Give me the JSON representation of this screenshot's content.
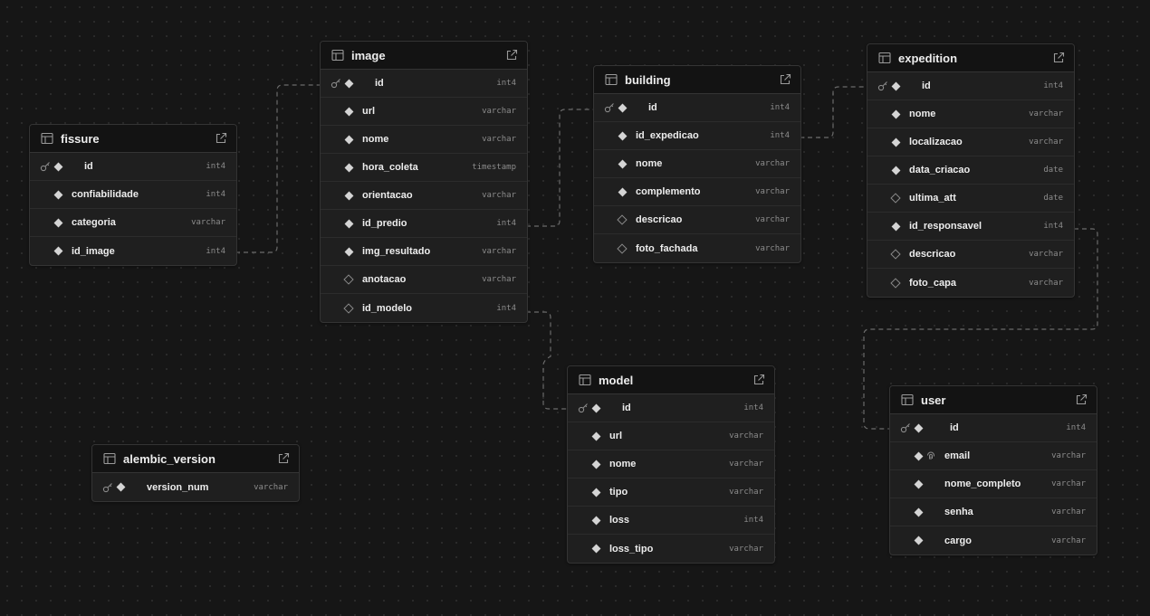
{
  "tables": {
    "fissure": {
      "name": "fissure",
      "columns": [
        {
          "name": "id",
          "type": "int4",
          "pk": true,
          "nullable": false
        },
        {
          "name": "confiabilidade",
          "type": "int4",
          "pk": false,
          "nullable": false
        },
        {
          "name": "categoria",
          "type": "varchar",
          "pk": false,
          "nullable": false
        },
        {
          "name": "id_image",
          "type": "int4",
          "pk": false,
          "nullable": false
        }
      ]
    },
    "image": {
      "name": "image",
      "columns": [
        {
          "name": "id",
          "type": "int4",
          "pk": true,
          "nullable": false
        },
        {
          "name": "url",
          "type": "varchar",
          "pk": false,
          "nullable": false
        },
        {
          "name": "nome",
          "type": "varchar",
          "pk": false,
          "nullable": false
        },
        {
          "name": "hora_coleta",
          "type": "timestamp",
          "pk": false,
          "nullable": false
        },
        {
          "name": "orientacao",
          "type": "varchar",
          "pk": false,
          "nullable": false
        },
        {
          "name": "id_predio",
          "type": "int4",
          "pk": false,
          "nullable": false
        },
        {
          "name": "img_resultado",
          "type": "varchar",
          "pk": false,
          "nullable": false
        },
        {
          "name": "anotacao",
          "type": "varchar",
          "pk": false,
          "nullable": true
        },
        {
          "name": "id_modelo",
          "type": "int4",
          "pk": false,
          "nullable": true
        }
      ]
    },
    "building": {
      "name": "building",
      "columns": [
        {
          "name": "id",
          "type": "int4",
          "pk": true,
          "nullable": false
        },
        {
          "name": "id_expedicao",
          "type": "int4",
          "pk": false,
          "nullable": false
        },
        {
          "name": "nome",
          "type": "varchar",
          "pk": false,
          "nullable": false
        },
        {
          "name": "complemento",
          "type": "varchar",
          "pk": false,
          "nullable": false
        },
        {
          "name": "descricao",
          "type": "varchar",
          "pk": false,
          "nullable": true
        },
        {
          "name": "foto_fachada",
          "type": "varchar",
          "pk": false,
          "nullable": true
        }
      ]
    },
    "expedition": {
      "name": "expedition",
      "columns": [
        {
          "name": "id",
          "type": "int4",
          "pk": true,
          "nullable": false
        },
        {
          "name": "nome",
          "type": "varchar",
          "pk": false,
          "nullable": false
        },
        {
          "name": "localizacao",
          "type": "varchar",
          "pk": false,
          "nullable": false
        },
        {
          "name": "data_criacao",
          "type": "date",
          "pk": false,
          "nullable": false
        },
        {
          "name": "ultima_att",
          "type": "date",
          "pk": false,
          "nullable": true
        },
        {
          "name": "id_responsavel",
          "type": "int4",
          "pk": false,
          "nullable": false
        },
        {
          "name": "descricao",
          "type": "varchar",
          "pk": false,
          "nullable": true
        },
        {
          "name": "foto_capa",
          "type": "varchar",
          "pk": false,
          "nullable": true
        }
      ]
    },
    "model": {
      "name": "model",
      "columns": [
        {
          "name": "id",
          "type": "int4",
          "pk": true,
          "nullable": false
        },
        {
          "name": "url",
          "type": "varchar",
          "pk": false,
          "nullable": false
        },
        {
          "name": "nome",
          "type": "varchar",
          "pk": false,
          "nullable": false
        },
        {
          "name": "tipo",
          "type": "varchar",
          "pk": false,
          "nullable": false
        },
        {
          "name": "loss",
          "type": "int4",
          "pk": false,
          "nullable": false
        },
        {
          "name": "loss_tipo",
          "type": "varchar",
          "pk": false,
          "nullable": false
        }
      ]
    },
    "user": {
      "name": "user",
      "columns": [
        {
          "name": "id",
          "type": "int4",
          "pk": true,
          "nullable": false
        },
        {
          "name": "email",
          "type": "varchar",
          "pk": false,
          "nullable": false,
          "unique": true
        },
        {
          "name": "nome_completo",
          "type": "varchar",
          "pk": false,
          "nullable": false
        },
        {
          "name": "senha",
          "type": "varchar",
          "pk": false,
          "nullable": false
        },
        {
          "name": "cargo",
          "type": "varchar",
          "pk": false,
          "nullable": false
        }
      ]
    },
    "alembic_version": {
      "name": "alembic_version",
      "columns": [
        {
          "name": "version_num",
          "type": "varchar",
          "pk": true,
          "nullable": false
        }
      ]
    }
  },
  "relations": [
    {
      "from": "fissure.id_image",
      "to": "image.id"
    },
    {
      "from": "image.id_predio",
      "to": "building.id"
    },
    {
      "from": "image.id_modelo",
      "to": "model.id"
    },
    {
      "from": "building.id_expedicao",
      "to": "expedition.id"
    },
    {
      "from": "expedition.id_responsavel",
      "to": "user.id"
    }
  ],
  "icons": {
    "table_header": "table-icon",
    "open_table": "external-link-icon",
    "primary_key": "key-icon",
    "required": "filled-diamond-icon",
    "nullable": "hollow-diamond-icon",
    "unique": "fingerprint-icon"
  },
  "colors": {
    "canvas": "#161616",
    "card": "#1f1f1f",
    "header": "#131313",
    "edge": "#6b6b6b"
  }
}
